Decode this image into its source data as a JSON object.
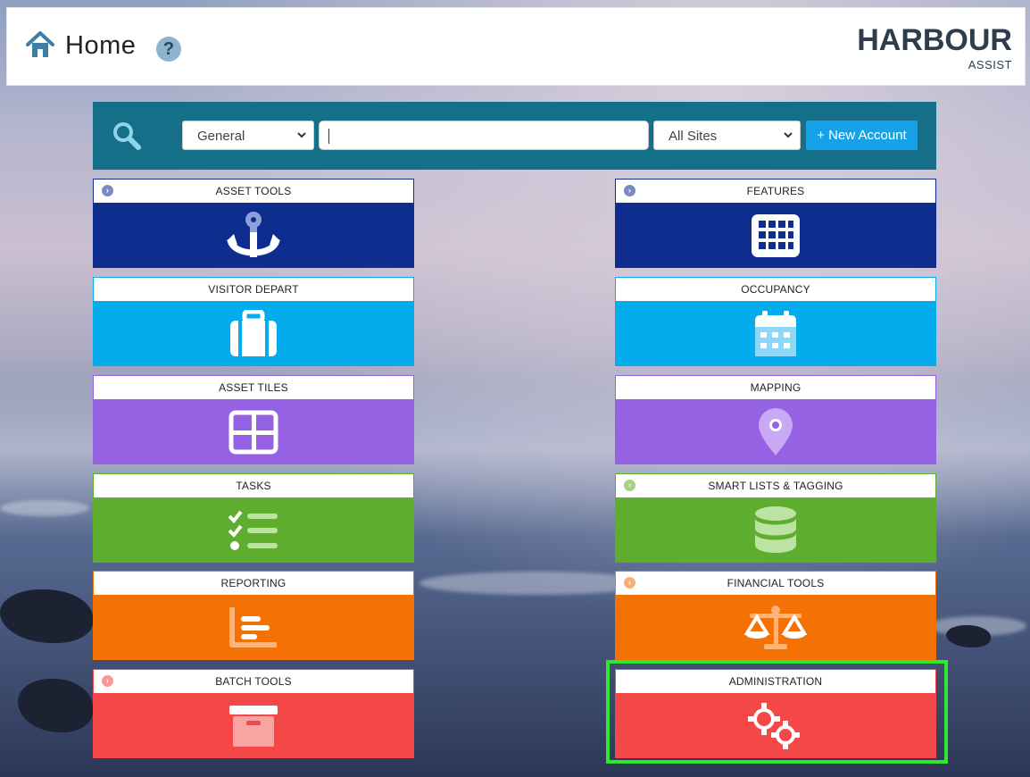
{
  "header": {
    "title": "Home",
    "help_label": "?",
    "logo_main": "HARBOUR",
    "logo_sub": "ASSIST"
  },
  "search": {
    "category_value": "General",
    "input_value": "",
    "site_value": "All Sites",
    "new_account_label": "+ New Account"
  },
  "tiles": [
    {
      "label": "ASSET TOOLS",
      "color": "#0e2d8f",
      "icon": "anchor-icon",
      "expandable": true
    },
    {
      "label": "FEATURES",
      "color": "#0e2d8f",
      "icon": "grid-icon",
      "expandable": true
    },
    {
      "label": "VISITOR DEPART",
      "color": "#04aced",
      "icon": "suitcase-icon",
      "expandable": false
    },
    {
      "label": "OCCUPANCY",
      "color": "#04aced",
      "icon": "calendar-icon",
      "expandable": false
    },
    {
      "label": "ASSET TILES",
      "color": "#9462e2",
      "icon": "tiles-icon",
      "expandable": false
    },
    {
      "label": "MAPPING",
      "color": "#9462e2",
      "icon": "map-pin-icon",
      "expandable": false
    },
    {
      "label": "TASKS",
      "color": "#5ead2e",
      "icon": "checklist-icon",
      "expandable": false
    },
    {
      "label": "SMART LISTS & TAGGING",
      "color": "#5ead2e",
      "icon": "database-icon",
      "expandable": true
    },
    {
      "label": "REPORTING",
      "color": "#f47104",
      "icon": "bar-chart-icon",
      "expandable": false
    },
    {
      "label": "FINANCIAL TOOLS",
      "color": "#f47104",
      "icon": "scales-icon",
      "expandable": true
    },
    {
      "label": "BATCH TOOLS",
      "color": "#f44747",
      "icon": "archive-box-icon",
      "expandable": true
    },
    {
      "label": "ADMINISTRATION",
      "color": "#f44747",
      "icon": "gears-icon",
      "expandable": false
    }
  ]
}
